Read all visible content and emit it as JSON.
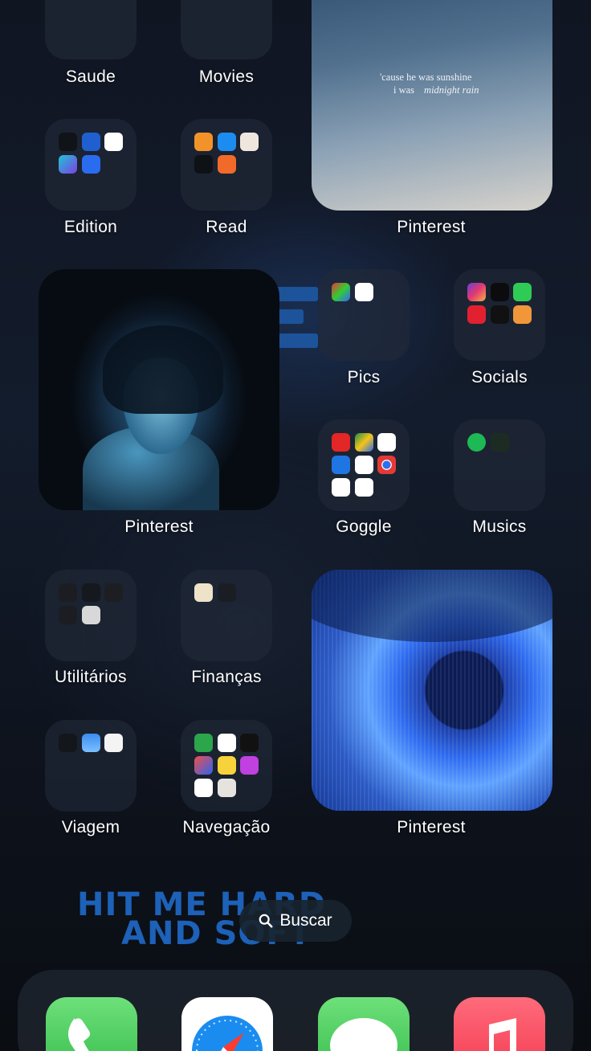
{
  "folders": {
    "saude": "Saude",
    "movies": "Movies",
    "edition": "Edition",
    "read": "Read",
    "pics": "Pics",
    "socials": "Socials",
    "goggle": "Goggle",
    "musics": "Musics",
    "utilitarios": "Utilitários",
    "financas": "Finanças",
    "viagem": "Viagem",
    "navegacao": "Navegação"
  },
  "widgets": {
    "top_label": "Pinterest",
    "middle_label": "Pinterest",
    "bottom_label": "Pinterest",
    "quote_line1": "'cause he was sunshine",
    "quote_line2": "i was",
    "quote_line2_italic": "midnight rain"
  },
  "wallpaper_text": {
    "line1": "HIT ME HARD",
    "line2": "AND SOFT"
  },
  "search": {
    "label": "Buscar"
  },
  "dock": {
    "apps": [
      "phone",
      "safari",
      "messages",
      "music"
    ]
  },
  "colors": {
    "background": "#101522",
    "wallpaper_text": "#1d61b8",
    "dock_phone": "#2fb846",
    "dock_music": "#f2344b"
  }
}
